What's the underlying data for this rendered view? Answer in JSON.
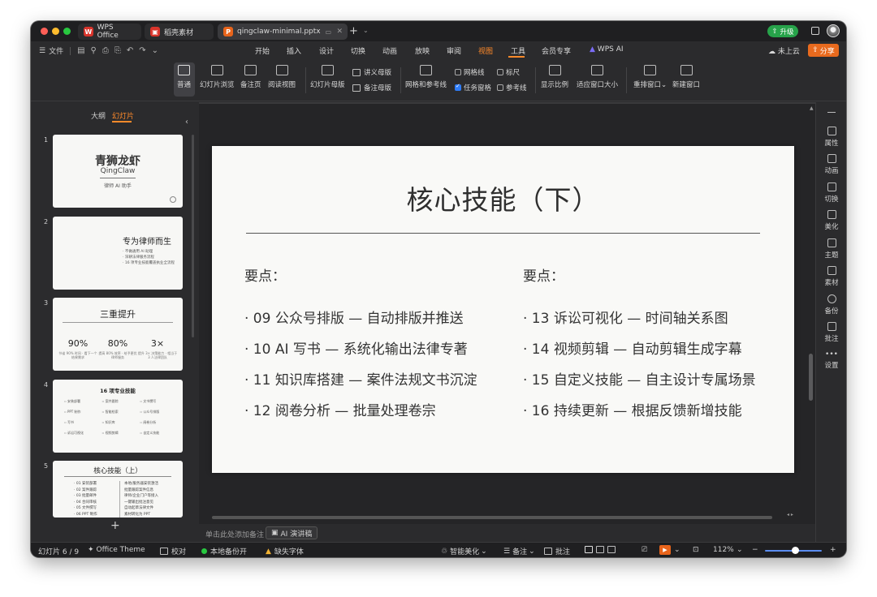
{
  "tabs": {
    "wps": "WPS Office",
    "resources": "稻壳素材",
    "document": "qingclaw-minimal.pptx"
  },
  "titlebar": {
    "upgrade": "升级"
  },
  "menu": {
    "file": "文件",
    "items": [
      "开始",
      "插入",
      "设计",
      "切换",
      "动画",
      "放映",
      "审阅",
      "视图",
      "工具",
      "会员专享",
      "WPS AI"
    ],
    "active": "视图",
    "cloud": "未上云",
    "share": "分享"
  },
  "ribbon": {
    "normal": "普通",
    "slide_sorter": "幻灯片浏览",
    "notes_page": "备注页",
    "reading_view": "阅读视图",
    "slide_master": "幻灯片母版",
    "handout_master": "讲义母版",
    "notes_master": "备注母版",
    "grid_guides": "网格和参考线",
    "gridlines": "网格线",
    "task_pane": "任务窗格",
    "ruler": "标尺",
    "guides": "参考线",
    "zoom": "显示比例",
    "fit_window": "适应窗口大小",
    "arrange": "重排窗口",
    "new_window": "新建窗口"
  },
  "left_panel": {
    "outline_tab": "大纲",
    "slides_tab": "幻灯片",
    "thumbnails": [
      {
        "num": "1",
        "title": "青狮龙虾",
        "subtitle": "QingClaw",
        "tag": "律师 AI 助手"
      },
      {
        "num": "2",
        "title": "专为律师而生",
        "lines": [
          "· 不做通用 AI 助理",
          "· 深耕法律服务流程",
          "· 16 项专业技能覆盖执业全流程"
        ]
      },
      {
        "num": "3",
        "title": "三重提升",
        "stats": [
          {
            "value": "90%",
            "caption": "节省 90% 时间 · 看下一个结果需求"
          },
          {
            "value": "80%",
            "caption": "提高 80% 效率 · 给予更优律师服务"
          },
          {
            "value": "3×",
            "caption": "提升 3× 决策能力 · 相当于 3 人法律团队"
          }
        ]
      },
      {
        "num": "4",
        "title": "16 项专业技能",
        "items": [
          "安装部署",
          "案件跟踪",
          "文书撰写",
          "PPT 制作",
          "智能检索",
          "公众号排版",
          "写书",
          "知识库",
          "阅卷分析",
          "诉讼可视化",
          "视频剪辑",
          "自定义技能"
        ]
      },
      {
        "num": "5",
        "title": "核心技能（上）",
        "left": [
          "· 01 安装部署",
          "· 02 案件跟踪",
          "· 03 批量邮件",
          "· 04 合同审核",
          "· 05 文件撰写",
          "· 06 PPT 制作"
        ],
        "right": [
          "本地/服务器安装激活",
          "批量跟踪案件信息",
          "律师/企业门户等接入",
          "一键输出批注意见",
          "自动起草法律文件",
          "素材转化为 PPT"
        ]
      }
    ]
  },
  "slide": {
    "title": "核心技能（下）",
    "left_heading": "要点：",
    "right_heading": "要点：",
    "left_items": [
      "· 09 公众号排版 — 自动排版并推送",
      "· 10 AI 写书 — 系统化输出法律专著",
      "· 11 知识库搭建 — 案件法规文书沉淀",
      "· 12 阅卷分析 — 批量处理卷宗"
    ],
    "right_items": [
      "· 13 诉讼可视化 — 时间轴关系图",
      "· 14 视频剪辑 — 自动剪辑生成字幕",
      "· 15 自定义技能 — 自主设计专属场景",
      "· 16 持续更新 — 根据反馈新增技能"
    ]
  },
  "notes": {
    "placeholder": "单击此处添加备注",
    "ai_button": "AI 演讲稿"
  },
  "right_rail": [
    "属性",
    "动画",
    "切换",
    "美化",
    "主题",
    "素材",
    "备份",
    "批注",
    "设置"
  ],
  "status": {
    "slide_count": "幻灯片 6 / 9",
    "theme": "Office Theme",
    "proof": "校对",
    "backup": "本地备份开",
    "missing_font": "缺失字体",
    "beautify": "智能美化",
    "notes": "备注",
    "comments": "批注",
    "zoom": "112%"
  }
}
